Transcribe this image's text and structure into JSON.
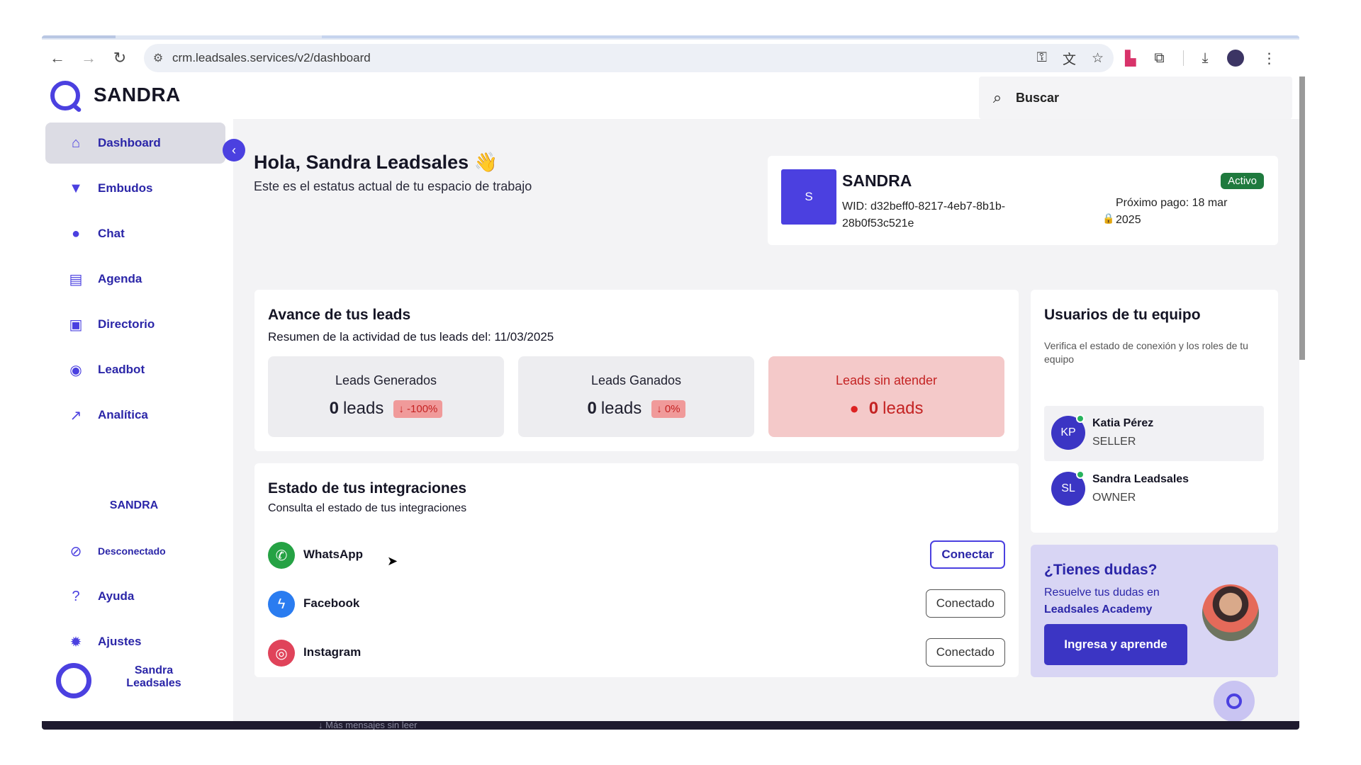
{
  "browser": {
    "url": "crm.leadsales.services/v2/dashboard"
  },
  "header": {
    "brand": "SANDRA",
    "search_label": "Buscar"
  },
  "sidebar": {
    "items": [
      {
        "label": "Dashboard",
        "icon": "home-icon"
      },
      {
        "label": "Embudos",
        "icon": "funnel-icon"
      },
      {
        "label": "Chat",
        "icon": "chat-icon"
      },
      {
        "label": "Agenda",
        "icon": "calendar-icon"
      },
      {
        "label": "Directorio",
        "icon": "contact-card-icon"
      },
      {
        "label": "Leadbot",
        "icon": "bot-icon"
      },
      {
        "label": "Analítica",
        "icon": "trend-icon"
      }
    ],
    "workspace_name": "SANDRA",
    "bottom_items": [
      {
        "label": "Desconectado",
        "icon": "signal-off-icon"
      },
      {
        "label": "Ayuda",
        "icon": "help-icon"
      },
      {
        "label": "Ajustes",
        "icon": "gear-icon"
      }
    ],
    "user_name": "Sandra Leadsales"
  },
  "greeting": {
    "title": "Hola, Sandra Leadsales 👋",
    "subtitle": "Este es el estatus actual de tu espacio de trabajo"
  },
  "workspace": {
    "avatar_letter": "S",
    "name": "SANDRA",
    "wid": "WID: d32beff0-8217-4eb7-8b1b-28b0f53c521e",
    "status": "Activo",
    "next_payment": "Próximo pago: 18 mar 2025"
  },
  "leads": {
    "title": "Avance de tus leads",
    "subtitle": "Resumen de la actividad de tus leads del: 11/03/2025",
    "stats": [
      {
        "label": "Leads Generados",
        "count": "0",
        "unit": "leads",
        "change": "↓ -100%"
      },
      {
        "label": "Leads Ganados",
        "count": "0",
        "unit": "leads",
        "change": "↓ 0%"
      },
      {
        "label": "Leads sin atender",
        "count": "0",
        "unit": "leads"
      }
    ]
  },
  "team": {
    "title": "Usuarios de tu equipo",
    "subtitle": "Verifica el estado de conexión y los roles de tu equipo",
    "members": [
      {
        "initials": "KP",
        "name": "Katia Pérez",
        "role": "SELLER"
      },
      {
        "initials": "SL",
        "name": "Sandra Leadsales",
        "role": "OWNER"
      }
    ]
  },
  "integrations": {
    "title": "Estado de tus integraciones",
    "subtitle": "Consulta el estado de tus integraciones",
    "items": [
      {
        "name": "WhatsApp",
        "button": "Conectar",
        "color": "#25a244"
      },
      {
        "name": "Facebook",
        "button": "Conectado",
        "color": "#2a7cf0"
      },
      {
        "name": "Instagram",
        "button": "Conectado",
        "color": "#e0435a"
      }
    ]
  },
  "help": {
    "title": "¿Tienes dudas?",
    "text": "Resuelve tus dudas en",
    "link": "Leadsales Academy",
    "button": "Ingresa y aprende"
  },
  "footer_hint": "↓ Más mensajes sin leer",
  "colors": {
    "primary": "#4b40e0",
    "nav_text": "#2b26a8",
    "status_active": "#1f7a3e",
    "alert_bg": "#f4c9c9",
    "alert_text": "#c42323"
  }
}
